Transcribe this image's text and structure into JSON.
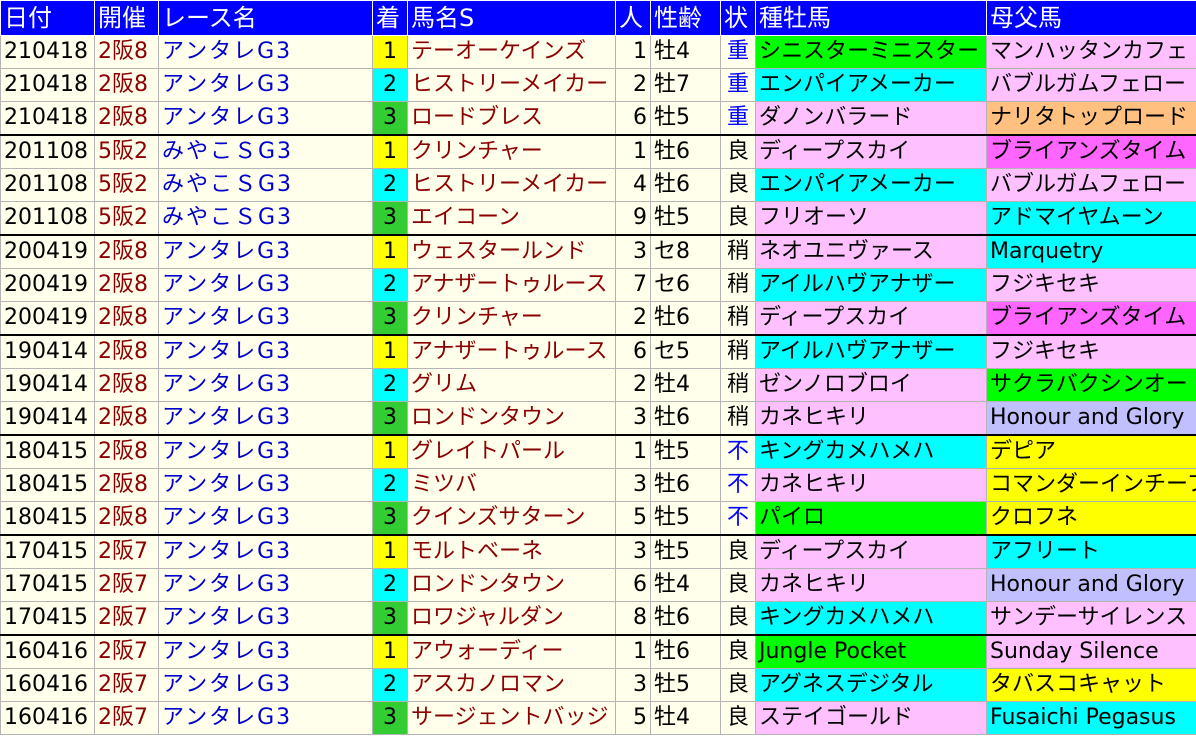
{
  "headers": [
    "日付",
    "開催",
    "レース名",
    "着",
    "馬名S",
    "人",
    "性齢",
    "状",
    "種牡馬",
    "母父馬"
  ],
  "rows": [
    {
      "date": "210418",
      "kaisai": "2阪8",
      "race": "アンタレG3",
      "rank": "1",
      "horse": "テーオーケインズ",
      "ninki": "1",
      "seirei": "牡4",
      "baba": "重",
      "sire": "シニスターミニスター",
      "sire_bg": "#00ff00",
      "bms": "マンハッタンカフェ",
      "bms_bg": "#ffc0ff"
    },
    {
      "date": "210418",
      "kaisai": "2阪8",
      "race": "アンタレG3",
      "rank": "2",
      "horse": "ヒストリーメイカー",
      "ninki": "2",
      "seirei": "牡7",
      "baba": "重",
      "sire": "エンパイアメーカー",
      "sire_bg": "#00ffff",
      "bms": "バブルガムフェロー",
      "bms_bg": "#ffc0ff"
    },
    {
      "date": "210418",
      "kaisai": "2阪8",
      "race": "アンタレG3",
      "rank": "3",
      "horse": "ロードブレス",
      "ninki": "6",
      "seirei": "牡5",
      "baba": "重",
      "sire": "ダノンバラード",
      "sire_bg": "#ffc0ff",
      "bms": "ナリタトップロード",
      "bms_bg": "#ffc080"
    },
    {
      "date": "201108",
      "kaisai": "5阪2",
      "race": "みやこＳG3",
      "rank": "1",
      "horse": "クリンチャー",
      "ninki": "1",
      "seirei": "牡6",
      "baba": "良",
      "sire": "ディープスカイ",
      "sire_bg": "#ffc0ff",
      "bms": "ブライアンズタイム",
      "bms_bg": "#ff66ff"
    },
    {
      "date": "201108",
      "kaisai": "5阪2",
      "race": "みやこＳG3",
      "rank": "2",
      "horse": "ヒストリーメイカー",
      "ninki": "4",
      "seirei": "牡6",
      "baba": "良",
      "sire": "エンパイアメーカー",
      "sire_bg": "#00ffff",
      "bms": "バブルガムフェロー",
      "bms_bg": "#ffc0ff"
    },
    {
      "date": "201108",
      "kaisai": "5阪2",
      "race": "みやこＳG3",
      "rank": "3",
      "horse": "エイコーン",
      "ninki": "9",
      "seirei": "牡5",
      "baba": "良",
      "sire": "フリオーソ",
      "sire_bg": "#ffc0ff",
      "bms": "アドマイヤムーン",
      "bms_bg": "#00ffff"
    },
    {
      "date": "200419",
      "kaisai": "2阪8",
      "race": "アンタレG3",
      "rank": "1",
      "horse": "ウェスタールンド",
      "ninki": "3",
      "seirei": "セ8",
      "baba": "稍",
      "sire": "ネオユニヴァース",
      "sire_bg": "#ffc0ff",
      "bms": "Marquetry",
      "bms_bg": "#00ffff"
    },
    {
      "date": "200419",
      "kaisai": "2阪8",
      "race": "アンタレG3",
      "rank": "2",
      "horse": "アナザートゥルース",
      "ninki": "7",
      "seirei": "セ6",
      "baba": "稍",
      "sire": "アイルハヴアナザー",
      "sire_bg": "#00ffff",
      "bms": "フジキセキ",
      "bms_bg": "#ffc0ff"
    },
    {
      "date": "200419",
      "kaisai": "2阪8",
      "race": "アンタレG3",
      "rank": "3",
      "horse": "クリンチャー",
      "ninki": "2",
      "seirei": "牡6",
      "baba": "稍",
      "sire": "ディープスカイ",
      "sire_bg": "#ffc0ff",
      "bms": "ブライアンズタイム",
      "bms_bg": "#ff66ff"
    },
    {
      "date": "190414",
      "kaisai": "2阪8",
      "race": "アンタレG3",
      "rank": "1",
      "horse": "アナザートゥルース",
      "ninki": "6",
      "seirei": "セ5",
      "baba": "稍",
      "sire": "アイルハヴアナザー",
      "sire_bg": "#00ffff",
      "bms": "フジキセキ",
      "bms_bg": "#ffc0ff"
    },
    {
      "date": "190414",
      "kaisai": "2阪8",
      "race": "アンタレG3",
      "rank": "2",
      "horse": "グリム",
      "ninki": "2",
      "seirei": "牡4",
      "baba": "稍",
      "sire": "ゼンノロブロイ",
      "sire_bg": "#ffc0ff",
      "bms": "サクラバクシンオー",
      "bms_bg": "#00ff00"
    },
    {
      "date": "190414",
      "kaisai": "2阪8",
      "race": "アンタレG3",
      "rank": "3",
      "horse": "ロンドンタウン",
      "ninki": "3",
      "seirei": "牡6",
      "baba": "稍",
      "sire": "カネヒキリ",
      "sire_bg": "#ffc0ff",
      "bms": "Honour and Glory",
      "bms_bg": "#c0c0ff"
    },
    {
      "date": "180415",
      "kaisai": "2阪8",
      "race": "アンタレG3",
      "rank": "1",
      "horse": "グレイトパール",
      "ninki": "1",
      "seirei": "牡5",
      "baba": "不",
      "sire": "キングカメハメハ",
      "sire_bg": "#00ffff",
      "bms": "デピア",
      "bms_bg": "#ffff00"
    },
    {
      "date": "180415",
      "kaisai": "2阪8",
      "race": "アンタレG3",
      "rank": "2",
      "horse": "ミツバ",
      "ninki": "3",
      "seirei": "牡6",
      "baba": "不",
      "sire": "カネヒキリ",
      "sire_bg": "#ffc0ff",
      "bms": "コマンダーインチーフ",
      "bms_bg": "#ffff00"
    },
    {
      "date": "180415",
      "kaisai": "2阪8",
      "race": "アンタレG3",
      "rank": "3",
      "horse": "クインズサターン",
      "ninki": "5",
      "seirei": "牡5",
      "baba": "不",
      "sire": "パイロ",
      "sire_bg": "#00ff00",
      "bms": "クロフネ",
      "bms_bg": "#ffff00"
    },
    {
      "date": "170415",
      "kaisai": "2阪7",
      "race": "アンタレG3",
      "rank": "1",
      "horse": "モルトベーネ",
      "ninki": "3",
      "seirei": "牡5",
      "baba": "良",
      "sire": "ディープスカイ",
      "sire_bg": "#ffc0ff",
      "bms": "アフリート",
      "bms_bg": "#00ffff"
    },
    {
      "date": "170415",
      "kaisai": "2阪7",
      "race": "アンタレG3",
      "rank": "2",
      "horse": "ロンドンタウン",
      "ninki": "6",
      "seirei": "牡4",
      "baba": "良",
      "sire": "カネヒキリ",
      "sire_bg": "#ffc0ff",
      "bms": "Honour and Glory",
      "bms_bg": "#c0c0ff"
    },
    {
      "date": "170415",
      "kaisai": "2阪7",
      "race": "アンタレG3",
      "rank": "3",
      "horse": "ロワジャルダン",
      "ninki": "8",
      "seirei": "牡6",
      "baba": "良",
      "sire": "キングカメハメハ",
      "sire_bg": "#00ffff",
      "bms": "サンデーサイレンス",
      "bms_bg": "#ffc0ff"
    },
    {
      "date": "160416",
      "kaisai": "2阪7",
      "race": "アンタレG3",
      "rank": "1",
      "horse": "アウォーディー",
      "ninki": "1",
      "seirei": "牡6",
      "baba": "良",
      "sire": "Jungle Pocket",
      "sire_bg": "#00ff00",
      "bms": "Sunday Silence",
      "bms_bg": "#ffc0ff"
    },
    {
      "date": "160416",
      "kaisai": "2阪7",
      "race": "アンタレG3",
      "rank": "2",
      "horse": "アスカノロマン",
      "ninki": "3",
      "seirei": "牡5",
      "baba": "良",
      "sire": "アグネスデジタル",
      "sire_bg": "#00ffff",
      "bms": "タバスコキャット",
      "bms_bg": "#ffff00"
    },
    {
      "date": "160416",
      "kaisai": "2阪7",
      "race": "アンタレG3",
      "rank": "3",
      "horse": "サージェントバッジ",
      "ninki": "5",
      "seirei": "牡4",
      "baba": "良",
      "sire": "ステイゴールド",
      "sire_bg": "#ffc0ff",
      "bms": "Fusaichi Pegasus",
      "bms_bg": "#00ffff"
    }
  ]
}
